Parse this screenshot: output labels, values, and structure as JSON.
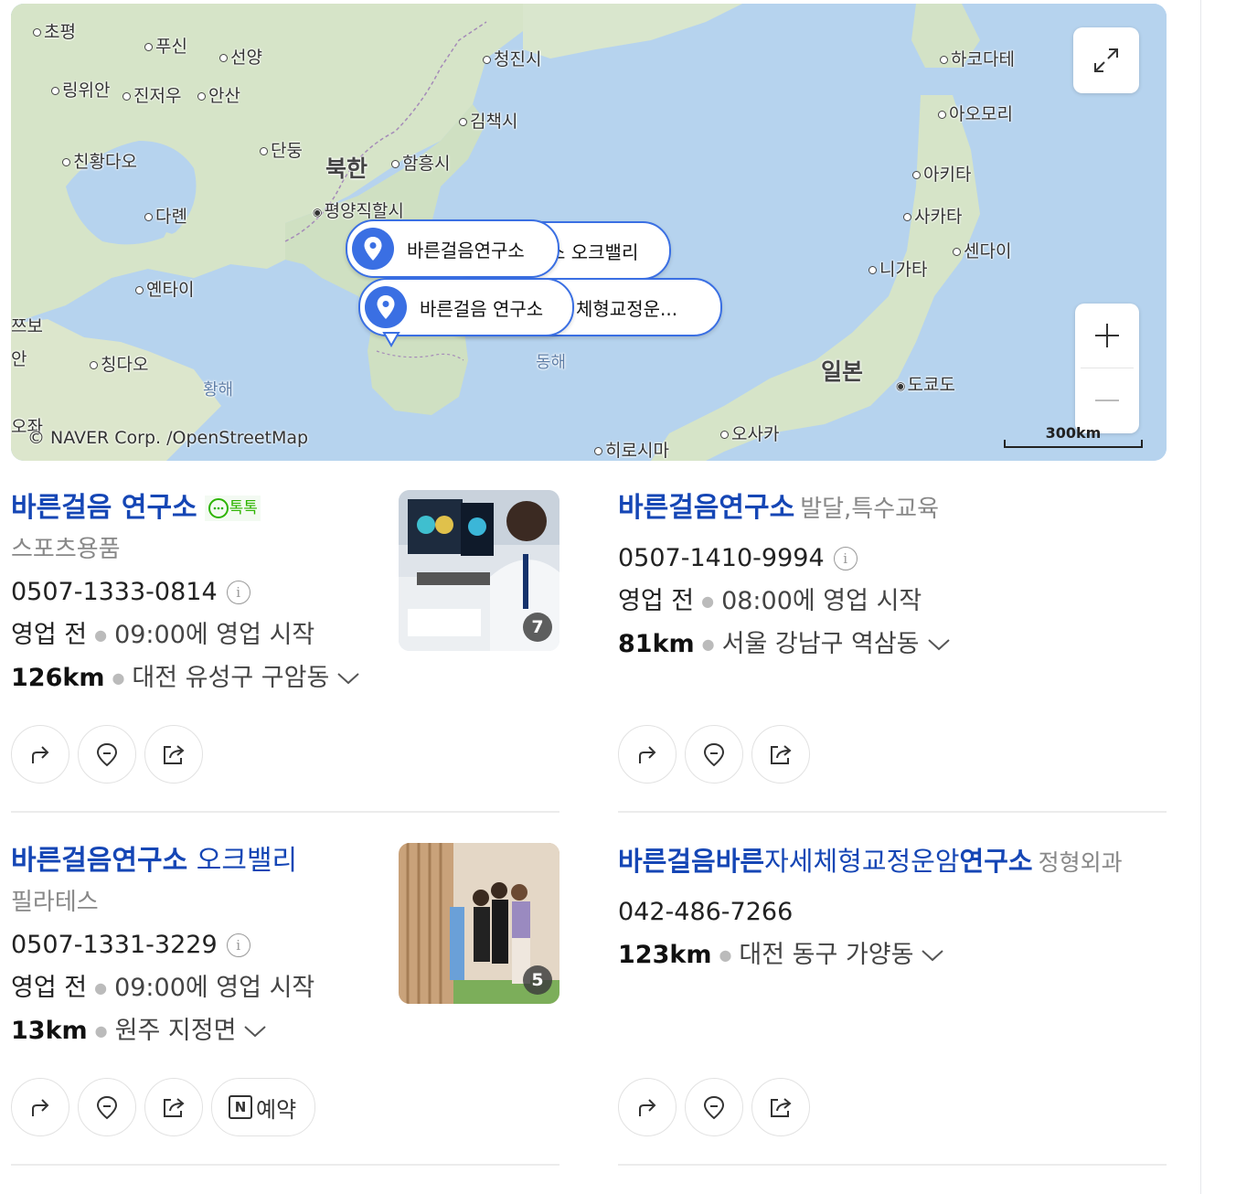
{
  "map": {
    "labels": [
      "초평",
      "푸신",
      "선양",
      "링위안",
      "진저우",
      "안산",
      "청진시",
      "하코다테",
      "아오모리",
      "김책시",
      "단둥",
      "친황다오",
      "북한",
      "함흥시",
      "아키타",
      "평양직할시",
      "사카타",
      "다롄",
      "센다이",
      "니가타",
      "옌타이",
      "쯔보",
      "칭다오",
      "동해",
      "일본",
      "도쿄도",
      "황해",
      "오사카",
      "히로시마",
      "안",
      "오좌"
    ],
    "copyright": "© NAVER Corp. /OpenStreetMap",
    "scale": "300km",
    "pins": [
      "바른걸음연구소",
      "소 오크밸리",
      "바른걸음 연구소",
      "체형교정운..."
    ],
    "icons": {
      "expand": "expand-icon",
      "zoom_in": "plus-icon",
      "zoom_out": "minus-icon",
      "pin": "location-pin-icon"
    }
  },
  "places": [
    {
      "name": "바른걸음 연구소",
      "talktalk": "톡톡",
      "category": "스포츠용품",
      "phone": "0507-1333-0814",
      "status": "영업 전",
      "hours": "09:00에 영업 시작",
      "distance": "126km",
      "address": "대전 유성구 구암동",
      "photo_count": "7"
    },
    {
      "name": "바른걸음연구소",
      "category": "발달,특수교육",
      "phone": "0507-1410-9994",
      "status": "영업 전",
      "hours": "08:00에 영업 시작",
      "distance": "81km",
      "address": "서울 강남구 역삼동"
    },
    {
      "name": "바른걸음연구소",
      "name_suffix": "오크밸리",
      "category": "필라테스",
      "phone": "0507-1331-3229",
      "status": "영업 전",
      "hours": "09:00에 영업 시작",
      "distance": "13km",
      "address": "원주 지정면",
      "photo_count": "5",
      "reserve": "예약"
    },
    {
      "name_parts": [
        "바른걸음바른",
        "자세체형교정운암",
        "연구소"
      ],
      "category": "정형외과",
      "phone": "042-486-7266",
      "distance": "123km",
      "address": "대전 동구 가양동"
    }
  ],
  "action_icons": [
    "directions-icon",
    "save-pin-icon",
    "share-icon"
  ],
  "colors": {
    "link": "#1546b5",
    "pin": "#3a6fe3",
    "talktalk": "#2db400"
  }
}
